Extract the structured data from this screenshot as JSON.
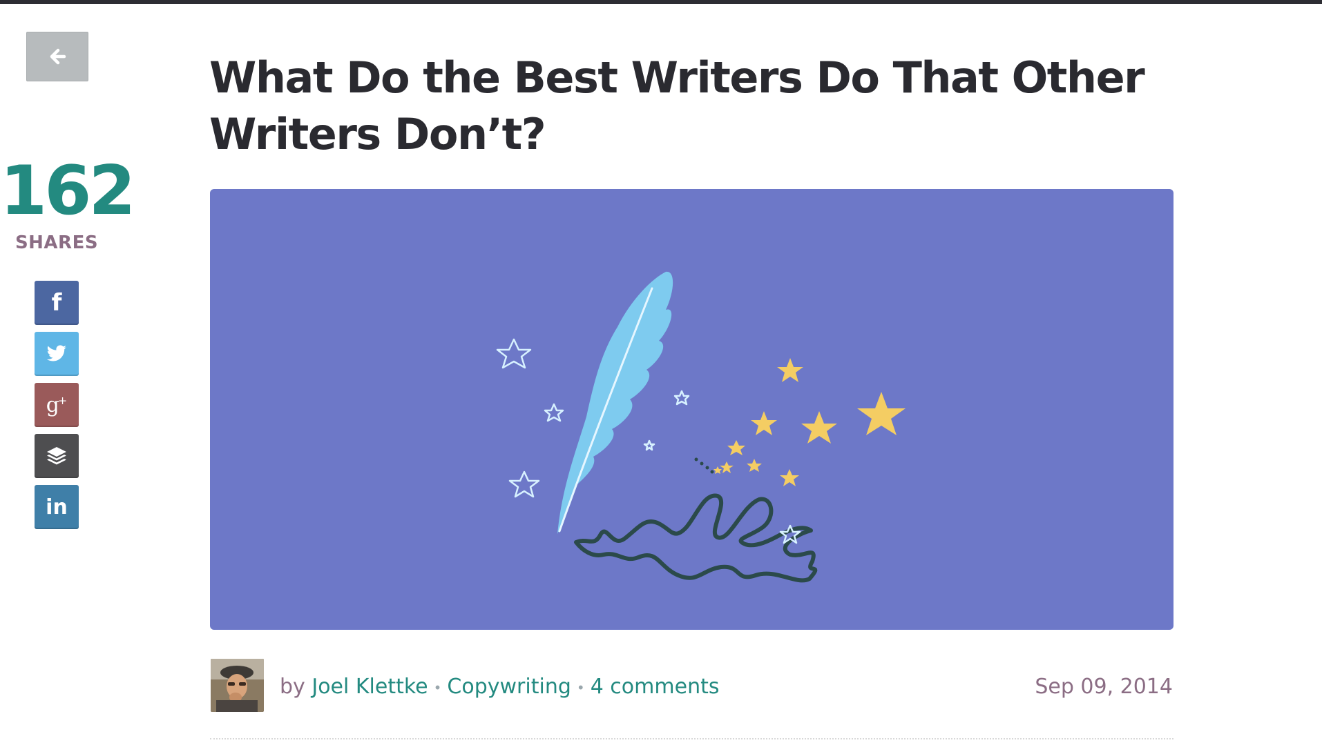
{
  "nav": {
    "back_icon": "arrow-left-icon"
  },
  "shares": {
    "count": "162",
    "label": "SHARES"
  },
  "social": [
    {
      "name": "facebook",
      "glyph": "f",
      "icon": "facebook-icon",
      "color": "#4c67a1"
    },
    {
      "name": "twitter",
      "glyph": "",
      "icon": "twitter-bird-icon",
      "color": "#5fb6e6"
    },
    {
      "name": "google-plus",
      "glyph": "g",
      "glyph_sup": "+",
      "icon": "google-plus-icon",
      "color": "#9a5a5a"
    },
    {
      "name": "buffer",
      "glyph": "",
      "icon": "buffer-stack-icon",
      "color": "#4e4e50"
    },
    {
      "name": "linkedin",
      "glyph": "in",
      "icon": "linkedin-icon",
      "color": "#3f7fa8"
    }
  ],
  "article": {
    "title_line1": "What Do the Best Writers Do That Other",
    "title_line2": "Writers Don’t?",
    "hero_image_icon": "feather-quill-with-stars-illustration",
    "hero_background": "#6d78c8",
    "byline_prefix": "by",
    "author": "Joel Klettke",
    "separator": "•",
    "category": "Copywriting",
    "comments": "4 comments",
    "date": "Sep 09, 2014"
  },
  "colors": {
    "accent": "#238a80",
    "muted": "#8b6d84",
    "title": "#2a2a30"
  }
}
